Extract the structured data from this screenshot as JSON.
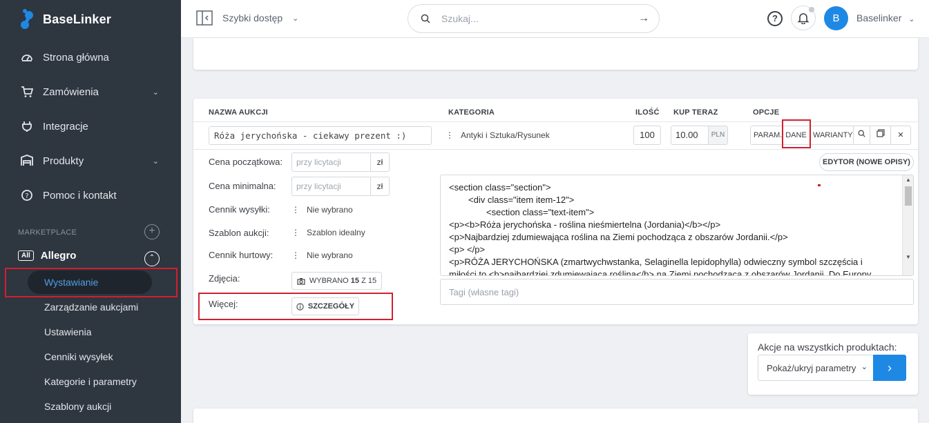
{
  "sidebar": {
    "brand": "BaseLinker",
    "items": [
      {
        "label": "Strona główna",
        "icon": "dashboard-icon"
      },
      {
        "label": "Zamówienia",
        "icon": "cart-icon"
      },
      {
        "label": "Integracje",
        "icon": "plug-icon"
      },
      {
        "label": "Produkty",
        "icon": "warehouse-icon"
      },
      {
        "label": "Pomoc i kontakt",
        "icon": "help-icon"
      }
    ],
    "section_label": "MARKETPLACE",
    "allegro": {
      "badge": "All",
      "label": "Allegro"
    },
    "subitems": [
      "Wystawianie",
      "Zarządzanie aukcjami",
      "Ustawienia",
      "Cenniki wysyłek",
      "Kategorie i parametry",
      "Szablony aukcji"
    ]
  },
  "topbar": {
    "quick_access": "Szybki dostęp",
    "search_placeholder": "Szukaj...",
    "avatar_letter": "B",
    "user_name": "Baselinker"
  },
  "table": {
    "headers": {
      "name": "NAZWA AUKCJI",
      "category": "KATEGORIA",
      "qty": "ILOŚĆ",
      "buy_now": "KUP TERAZ",
      "options": "OPCJE"
    },
    "row": {
      "name": "Róża jerychońska - ciekawy prezent :)",
      "category": "Antyki i Sztuka/Rysunek",
      "qty": "100",
      "price": "10.00",
      "currency": "PLN"
    },
    "option_buttons": [
      "PARAM.",
      "DANE",
      "WARIANTY"
    ]
  },
  "details": {
    "start_price_label": "Cena początkowa:",
    "min_price_label": "Cena minimalna:",
    "price_placeholder": "przy licytacji",
    "price_unit": "zł",
    "shipping_label": "Cennik wysyłki:",
    "shipping_value": "Nie wybrano",
    "template_label": "Szablon aukcji:",
    "template_value": "Szablon idealny",
    "wholesale_label": "Cennik hurtowy:",
    "wholesale_value": "Nie wybrano",
    "photos_label": "Zdjęcia:",
    "photos_btn_prefix": "WYBRANO",
    "photos_selected": "15",
    "photos_btn_mid": "Z",
    "photos_total": "15",
    "more_label": "Więcej:",
    "more_btn": "SZCZEGÓŁY"
  },
  "editor": {
    "button": "EDYTOR (NOWE OPISY)",
    "lines": [
      "<section class=\"section\">",
      "<div class=\"item item-12\">",
      "<section class=\"text-item\">",
      "<p><b>Róża jerychońska - roślina nieśmiertelna (Jordania)</b></p>",
      "<p>Najbardziej zdumiewająca roślina na Ziemi pochodząca z obszarów Jordanii.</p>",
      "<p> </p>",
      "<p>RÓŻA JERYCHOŃSKA (zmartwychwstanka, Selaginella lepidophylla) odwieczny symbol szczęścia i",
      "miłości to <b>najbardziej zdumiewająca roślina</b> na Ziemi pochodząca z obszarów Jordanii. Do Europy"
    ],
    "tags_placeholder": "Tagi (własne tagi)"
  },
  "bulk": {
    "title": "Akcje na wszystkich produktach:",
    "select_value": "Pokaż/ukryj parametry"
  },
  "colors": {
    "sidebar": "#2e3640",
    "accent": "#1e88e5",
    "highlight": "#d0202f"
  }
}
